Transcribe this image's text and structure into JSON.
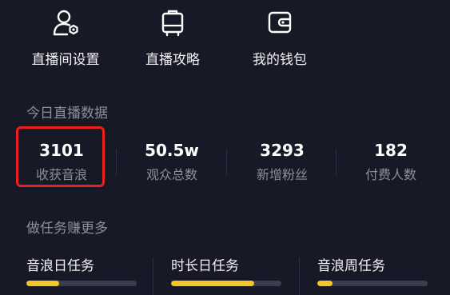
{
  "shortcuts": [
    {
      "label": "直播间设置",
      "icon": "user-settings-icon"
    },
    {
      "label": "直播攻略",
      "icon": "luggage-icon"
    },
    {
      "label": "我的钱包",
      "icon": "wallet-icon"
    }
  ],
  "today_stats": {
    "title": "今日直播数据",
    "items": [
      {
        "value": "3101",
        "label": "收获音浪"
      },
      {
        "value": "50.5w",
        "label": "观众总数"
      },
      {
        "value": "3293",
        "label": "新增粉丝"
      },
      {
        "value": "182",
        "label": "付费人数"
      }
    ],
    "highlight_color": "#e8201e"
  },
  "tasks": {
    "title": "做任务赚更多",
    "items": [
      {
        "label": "音浪日任务",
        "progress": 0.3
      },
      {
        "label": "时长日任务",
        "progress": 0.75
      },
      {
        "label": "音浪周任务",
        "progress": 0.14
      }
    ],
    "progress_color": "#f5c42a"
  }
}
